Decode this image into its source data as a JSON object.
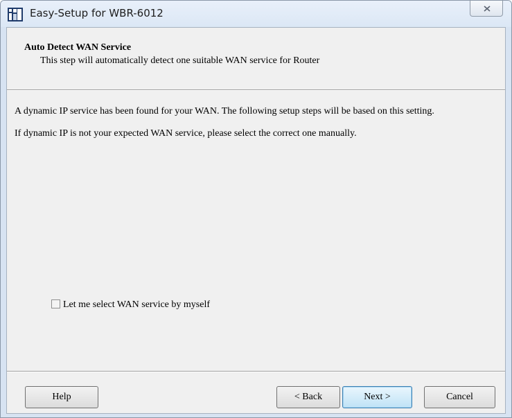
{
  "window": {
    "title": "Easy-Setup for WBR-6012",
    "app_icon": "levelone-logo-icon",
    "close_icon": "close-x-icon"
  },
  "header": {
    "title": "Auto Detect WAN Service",
    "subtitle": "This step will automatically detect one suitable WAN service for Router"
  },
  "body": {
    "paragraph1": "A dynamic IP service has been found for your WAN. The following setup steps will be based on this setting.",
    "paragraph2": "If dynamic IP is not your expected WAN service, please select the correct one manually."
  },
  "options": {
    "manual_select_label": "Let me select WAN service by myself",
    "manual_select_checked": false
  },
  "buttons": {
    "help": "Help",
    "back": "< Back",
    "next": "Next >",
    "cancel": "Cancel"
  }
}
